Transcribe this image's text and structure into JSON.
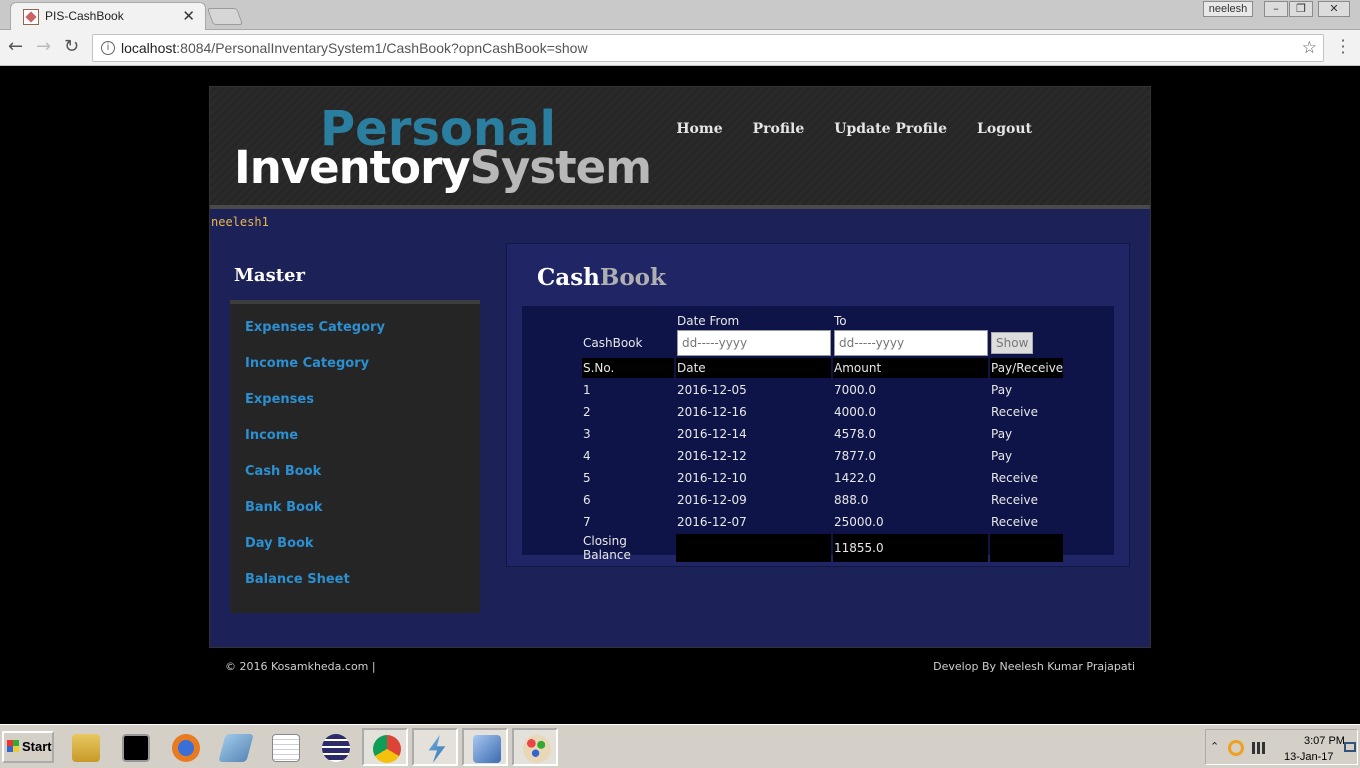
{
  "browser": {
    "tab_title": "PIS-CashBook",
    "tab_close": "✕",
    "user_chip": "neelesh",
    "url_host": "localhost",
    "url_rest": ":8084/PersonalInventarySystem1/CashBook?opnCashBook=show",
    "win_min": "–",
    "win_max": "❐",
    "win_close": "✕"
  },
  "header": {
    "logo_top": "Personal",
    "logo_inventory": "Inventory",
    "logo_system": "System",
    "nav": [
      "Home",
      "Profile",
      "Update Profile",
      "Logout"
    ]
  },
  "username": "neelesh1",
  "sidebar": {
    "title": "Master",
    "items": [
      "Expenses Category",
      "Income Category",
      "Expenses",
      "Income",
      "Cash Book",
      "Bank Book",
      "Day Book",
      "Balance Sheet"
    ]
  },
  "content": {
    "title_cash": "Cash",
    "title_book": "Book",
    "label_date_from": "Date From",
    "label_to": "To",
    "label_cashbook": "CashBook",
    "date_from_placeholder": "dd-----yyyy",
    "date_to_placeholder": "dd-----yyyy",
    "show_button": "Show",
    "columns": [
      "S.No.",
      "Date",
      "Amount",
      "Pay/Receive"
    ],
    "rows": [
      [
        "1",
        "2016-12-05",
        "7000.0",
        "Pay"
      ],
      [
        "2",
        "2016-12-16",
        "4000.0",
        "Receive"
      ],
      [
        "3",
        "2016-12-14",
        "4578.0",
        "Pay"
      ],
      [
        "4",
        "2016-12-12",
        "7877.0",
        "Pay"
      ],
      [
        "5",
        "2016-12-10",
        "1422.0",
        "Receive"
      ],
      [
        "6",
        "2016-12-09",
        "888.0",
        "Receive"
      ],
      [
        "7",
        "2016-12-07",
        "25000.0",
        "Receive"
      ]
    ],
    "closing_label": "Closing Balance",
    "closing_value": "11855.0"
  },
  "footer": {
    "left": "© 2016 Kosamkheda.com |",
    "right": "Develop By Neelesh Kumar Prajapati"
  },
  "taskbar": {
    "start": "Start",
    "time": "3:07 PM",
    "date": "13-Jan-17",
    "apps": [
      "file-explorer",
      "command-prompt",
      "firefox",
      "eraser",
      "notepad",
      "eclipse",
      "chrome",
      "bolt",
      "virtualbox",
      "paint"
    ]
  },
  "colors": {
    "page_bg": "#000000",
    "site_bg": "#1c2258",
    "link_blue": "#2b8fd0",
    "logo_blue": "#2a7fa0",
    "username_gold": "#e8b84a"
  }
}
